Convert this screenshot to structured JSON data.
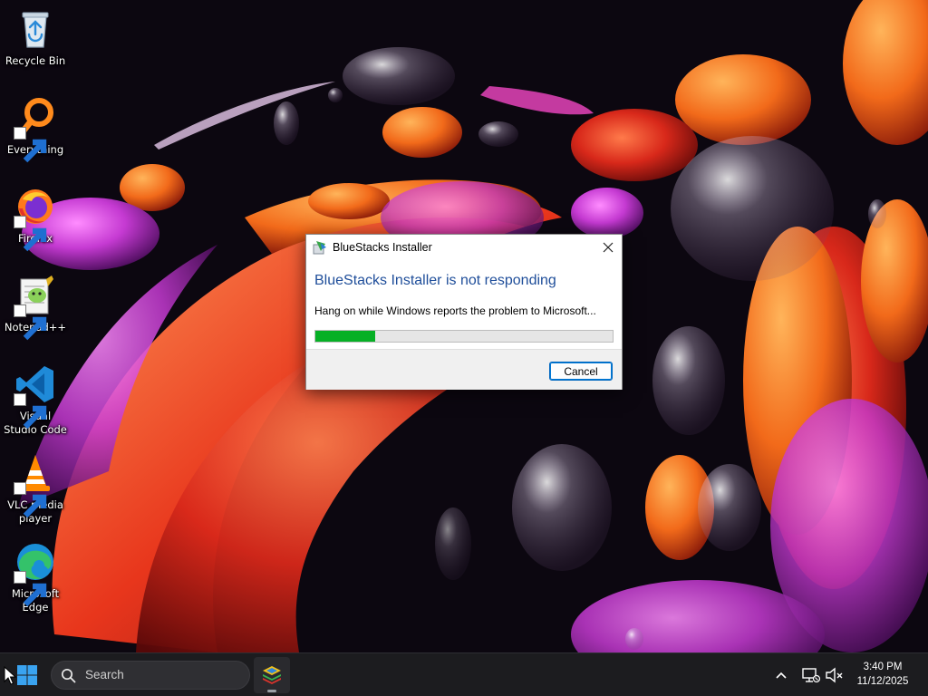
{
  "desktop": {
    "icons": [
      {
        "label": "Recycle Bin",
        "icon": "recycle-bin-icon"
      },
      {
        "label": "Everything",
        "icon": "everything-search-icon"
      },
      {
        "label": "Firefox",
        "icon": "firefox-icon"
      },
      {
        "label": "Notepad++",
        "icon": "notepad-plus-plus-icon"
      },
      {
        "label": "Visual Studio Code",
        "icon": "vscode-icon"
      },
      {
        "label": "VLC media player",
        "icon": "vlc-icon"
      },
      {
        "label": "Microsoft Edge",
        "icon": "edge-icon"
      }
    ]
  },
  "dialog": {
    "title": "BlueStacks Installer",
    "heading": "BlueStacks Installer is not responding",
    "message": "Hang on while Windows reports the problem to Microsoft...",
    "progress": 0.2,
    "cancel_label": "Cancel",
    "colors": {
      "heading": "#1f4e9a",
      "progress_fill": "#06b025",
      "button_border": "#0067c0"
    }
  },
  "taskbar": {
    "search_placeholder": "Search",
    "pinned_apps": [
      {
        "name": "BlueStacks",
        "icon": "bluestacks-icon"
      }
    ],
    "tray_icons": [
      "chevron-up-icon",
      "network-icon",
      "volume-muted-icon"
    ],
    "clock": {
      "time": "3:40 PM",
      "date": "11/12/2025"
    }
  }
}
